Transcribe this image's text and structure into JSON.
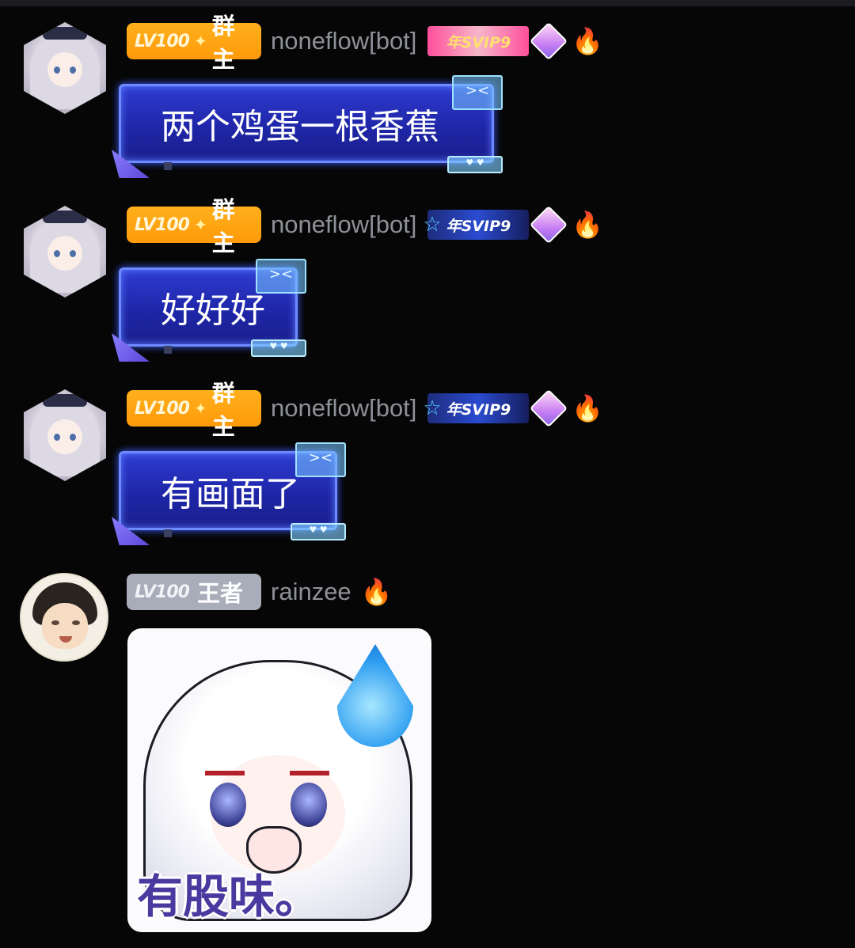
{
  "messages": [
    {
      "level": "LV100",
      "role": "群主",
      "username": "noneflow[bot]",
      "vip_badge": "年SVIP9",
      "vip_style": "pink",
      "icons": [
        "gem-icon",
        "fire-icon"
      ],
      "text": "两个鸡蛋一根香蕉"
    },
    {
      "level": "LV100",
      "role": "群主",
      "username": "noneflow[bot]",
      "vip_badge": "年SVIP9",
      "vip_style": "blue",
      "icons": [
        "gem-icon",
        "fire-icon"
      ],
      "text": "好好好"
    },
    {
      "level": "LV100",
      "role": "群主",
      "username": "noneflow[bot]",
      "vip_badge": "年SVIP9",
      "vip_style": "blue",
      "icons": [
        "gem-icon",
        "fire-icon"
      ],
      "text": "有画面了"
    },
    {
      "level": "LV100",
      "role": "王者",
      "username": "rainzee",
      "icons": [
        "fire-icon"
      ],
      "sticker_caption": "有股味。"
    }
  ],
  "colors": {
    "background": "#060606",
    "owner_badge": "#ffa412",
    "king_badge": "#a8adb9",
    "username": "#8f9198",
    "bubble": "#2431c0"
  }
}
